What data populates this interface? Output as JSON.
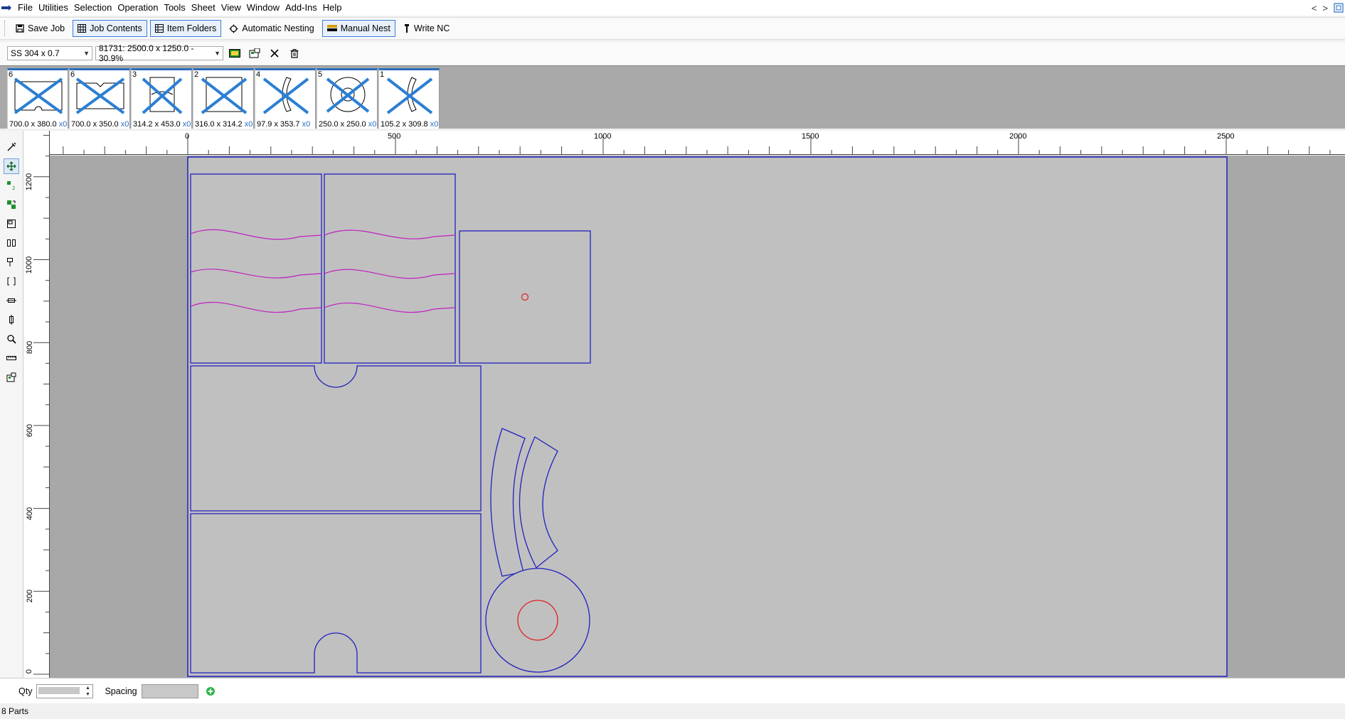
{
  "menu": {
    "items": [
      "File",
      "Utilities",
      "Selection",
      "Operation",
      "Tools",
      "Sheet",
      "View",
      "Window",
      "Add-Ins",
      "Help"
    ],
    "nav_prev": "<",
    "nav_next": ">"
  },
  "toolbar": {
    "save_job": "Save Job",
    "job_contents": "Job Contents",
    "item_folders": "Item Folders",
    "automatic_nesting": "Automatic Nesting",
    "manual_nest": "Manual Nest",
    "write_nc": "Write NC"
  },
  "sheet_bar": {
    "material": "SS 304 x 0.7",
    "sheet": "81731: 2500.0 x 1250.0 - 30.9%"
  },
  "parts": [
    {
      "qty": "6",
      "dims": "700.0 x 380.0",
      "remaining": "x0",
      "shape": "rect-notch"
    },
    {
      "qty": "6",
      "dims": "700.0 x 350.0",
      "remaining": "x0",
      "shape": "rect-vnotch"
    },
    {
      "qty": "3",
      "dims": "314.2 x 453.0",
      "remaining": "x0",
      "shape": "rect-hole"
    },
    {
      "qty": "2",
      "dims": "316.0 x 314.2",
      "remaining": "x0",
      "shape": "square"
    },
    {
      "qty": "4",
      "dims": "97.9 x 353.7",
      "remaining": "x0",
      "shape": "arc"
    },
    {
      "qty": "5",
      "dims": "250.0 x 250.0",
      "remaining": "x0",
      "shape": "ring"
    },
    {
      "qty": "1",
      "dims": "105.2 x 309.8",
      "remaining": "x0",
      "shape": "arc"
    }
  ],
  "ruler": {
    "x_labels": [
      "0",
      "500",
      "1000",
      "1500",
      "2000",
      "2500"
    ],
    "y_labels": [
      "1200",
      "1000",
      "800",
      "600",
      "400",
      "200",
      "0"
    ]
  },
  "bottom": {
    "qty_label": "Qty",
    "spacing_label": "Spacing"
  },
  "status": {
    "parts_count": "8 Parts"
  },
  "colors": {
    "part_outline": "#2020c0",
    "hole": "#e02020",
    "marking": "#c020c0",
    "accent": "#2a6ebd",
    "sheet": "#c0c0c0"
  }
}
